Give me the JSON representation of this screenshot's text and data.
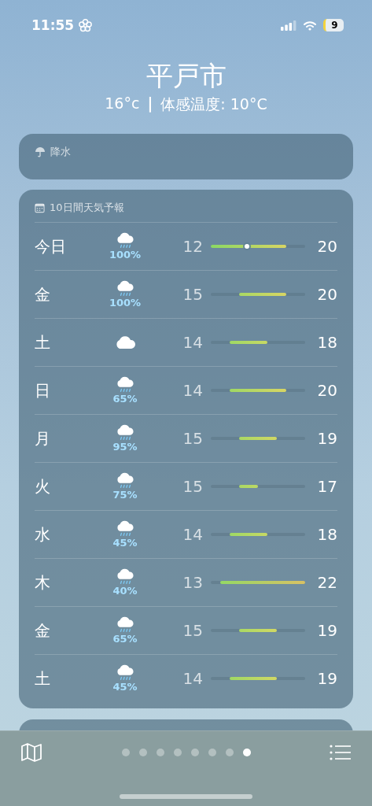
{
  "status_bar": {
    "time": "11:55",
    "battery": "9"
  },
  "location": {
    "city": "平戸市",
    "current": "16°c",
    "separator": "|",
    "feels_like": "体感温度: 10°C"
  },
  "precipitation_card": {
    "title": "降水"
  },
  "forecast": {
    "title": "10日間天気予報",
    "days": [
      {
        "day": "今日",
        "kind": "rain",
        "chance": "100%",
        "low": "12",
        "high": "20",
        "now": {
          "level": 0.38
        }
      },
      {
        "day": "金",
        "kind": "rain",
        "chance": "100%",
        "low": "15",
        "high": "20"
      },
      {
        "day": "土",
        "kind": "cloud",
        "low": "14",
        "high": "18"
      },
      {
        "day": "日",
        "kind": "rain",
        "chance": "65%",
        "low": "14",
        "high": "20"
      },
      {
        "day": "月",
        "kind": "rain",
        "chance": "95%",
        "low": "15",
        "high": "19"
      },
      {
        "day": "火",
        "kind": "rain",
        "chance": "75%",
        "low": "15",
        "high": "17"
      },
      {
        "day": "水",
        "kind": "rain",
        "chance": "45%",
        "low": "14",
        "high": "18"
      },
      {
        "day": "木",
        "kind": "rain",
        "chance": "40%",
        "low": "13",
        "high": "22"
      },
      {
        "day": "金",
        "kind": "rain",
        "chance": "65%",
        "low": "15",
        "high": "19"
      },
      {
        "day": "土",
        "kind": "rain",
        "chance": "45%",
        "low": "14",
        "high": "19"
      }
    ]
  },
  "page_dots": [
    {
      "selected": false
    },
    {
      "selected": false
    },
    {
      "selected": false
    },
    {
      "selected": false
    },
    {
      "selected": false
    },
    {
      "selected": false
    },
    {
      "selected": false
    },
    {
      "selected": true
    }
  ]
}
